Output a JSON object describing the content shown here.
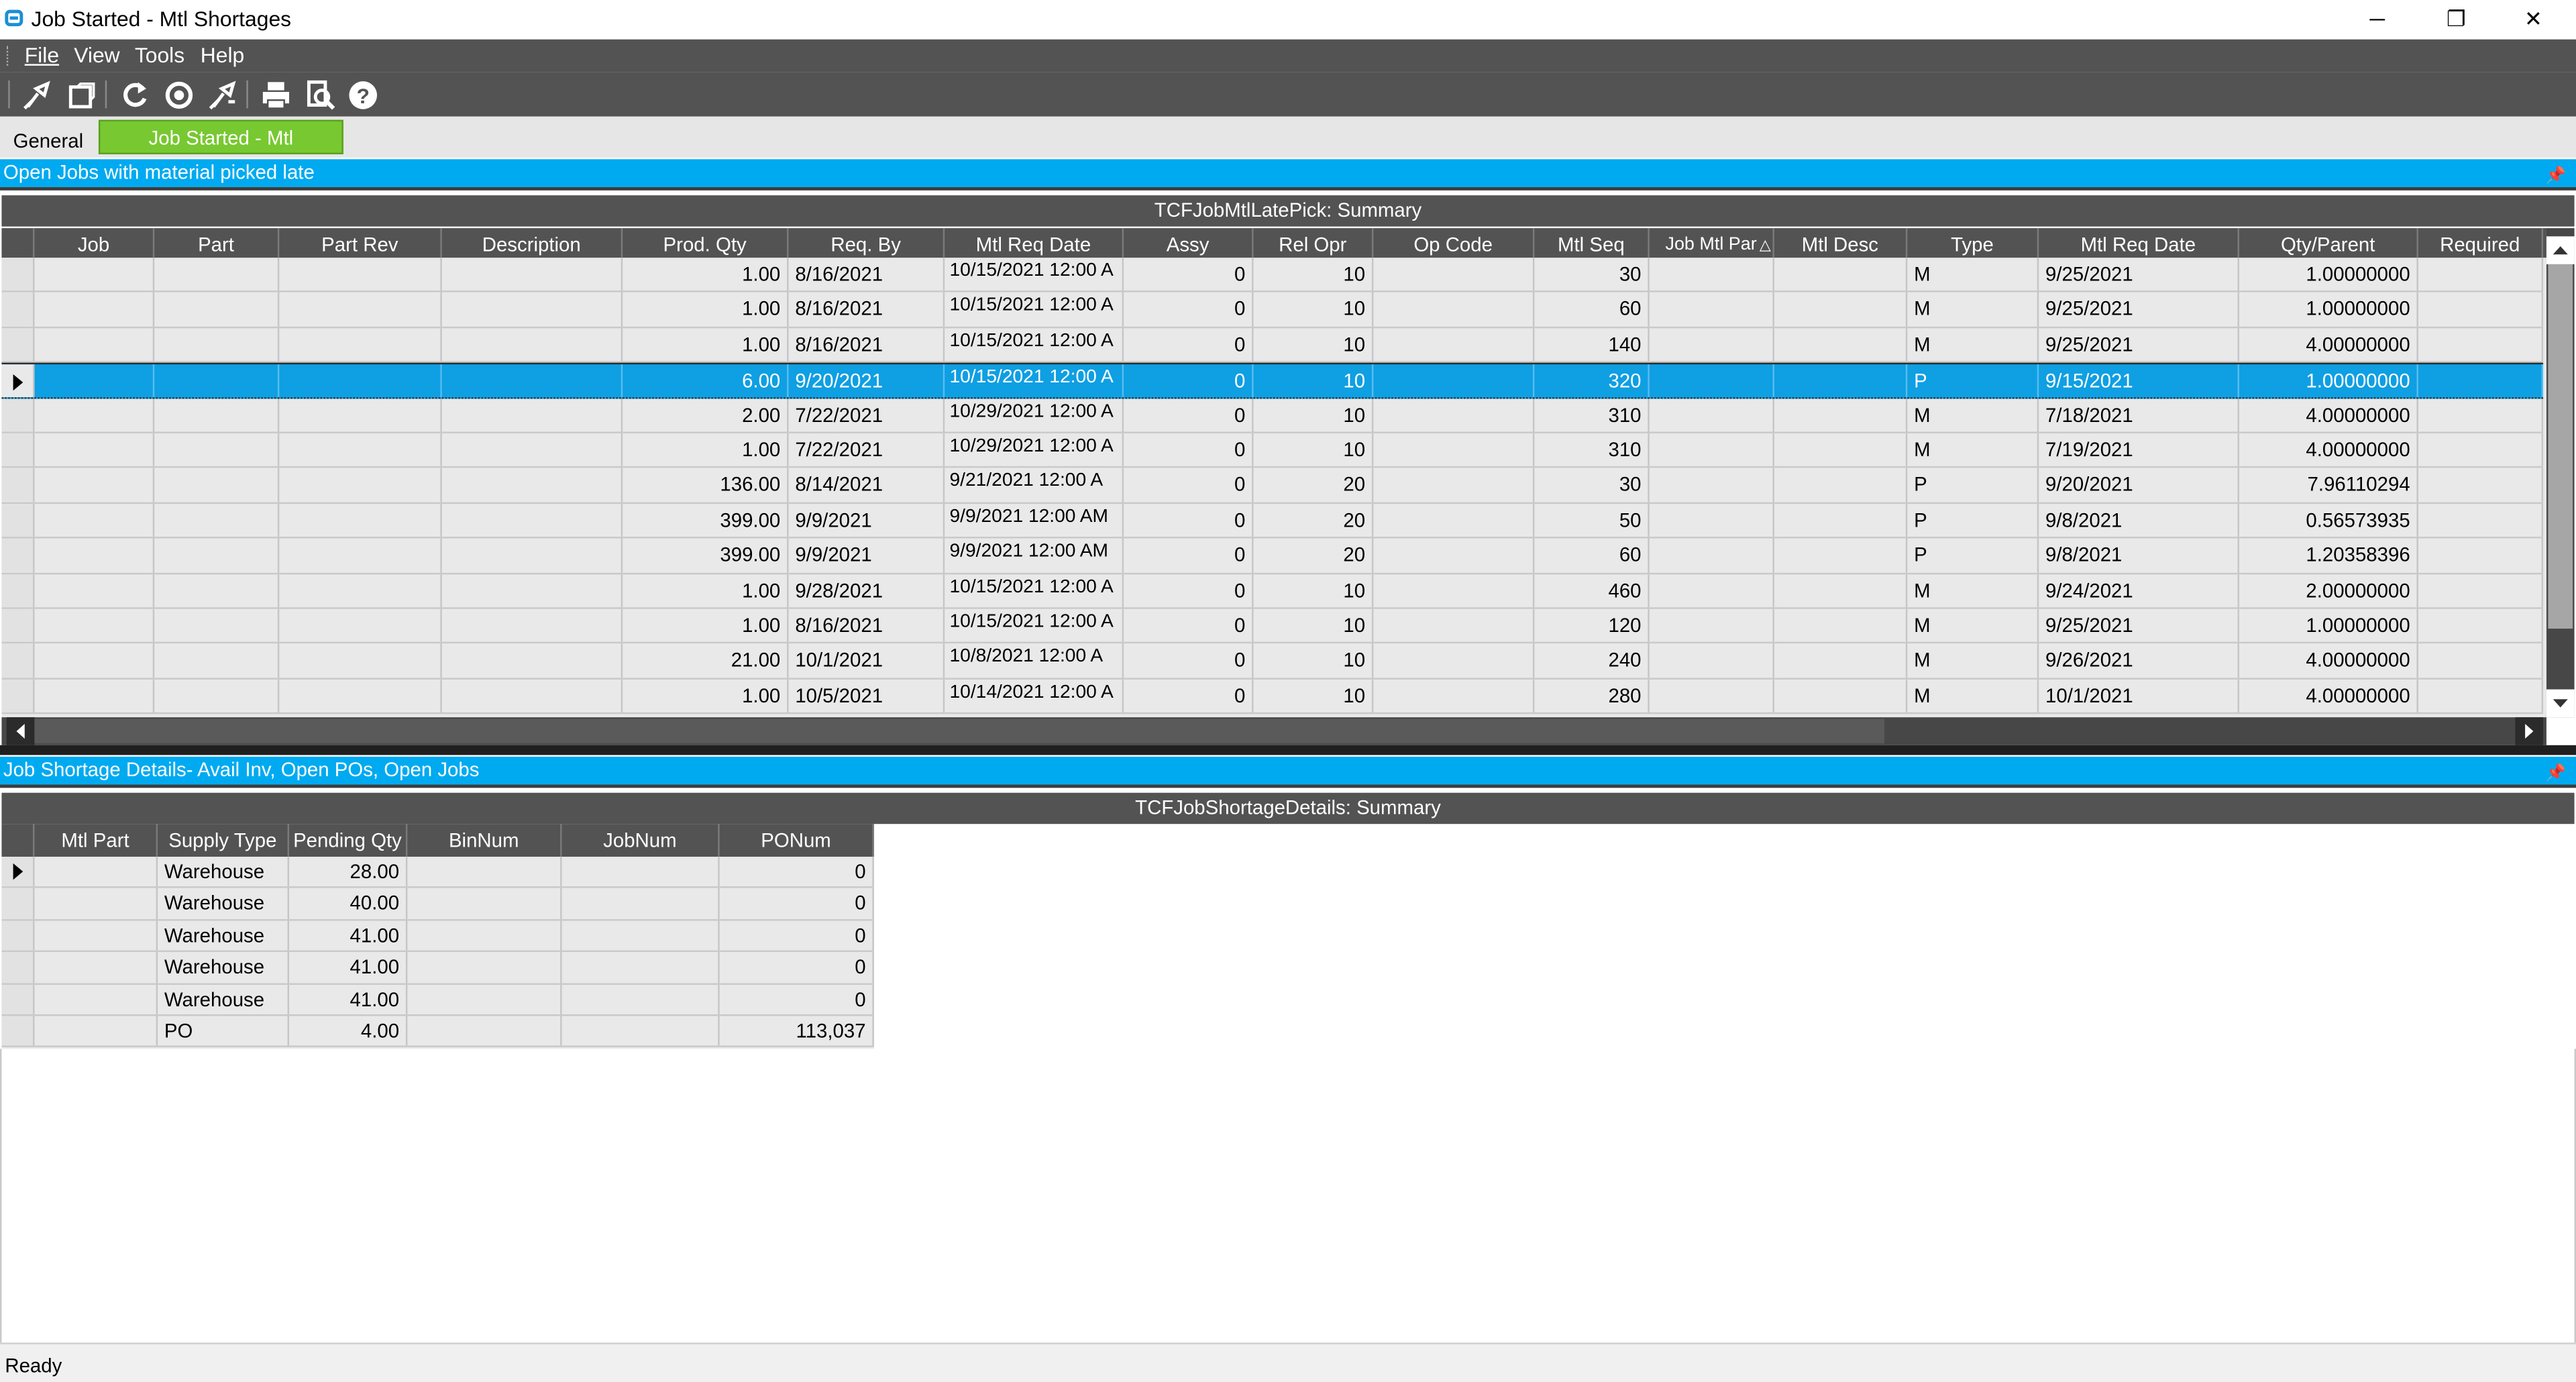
{
  "window": {
    "title": "Job Started - Mtl Shortages"
  },
  "menu": [
    "File",
    "View",
    "Tools",
    "Help"
  ],
  "toolbar_icons": [
    "clear-icon",
    "new-window-icon",
    "refresh-icon",
    "refresh-all-icon",
    "clear-all-icon",
    "print-icon",
    "print-preview-icon",
    "help-icon"
  ],
  "tabs": [
    {
      "label": "General",
      "active": false
    },
    {
      "label": "Job Started - Mtl Shortages",
      "active": true
    }
  ],
  "panel1": {
    "header": "Open Jobs with material picked late",
    "caption": "TCFJobMtlLatePick: Summary",
    "columns": [
      "Job",
      "Part",
      "Part Rev",
      "Description",
      "Prod. Qty",
      "Req. By",
      "Mtl Req Date",
      "Assy",
      "Rel Opr",
      "Op Code",
      "Mtl Seq",
      "Job Mtl Par",
      "Mtl Desc",
      "Type",
      "Mtl Req Date",
      "Qty/Parent",
      "Required"
    ],
    "selected_row": 3,
    "rows": [
      [
        "",
        "",
        "",
        "",
        "1.00",
        "8/16/2021",
        "10/15/2021 12:00 A",
        "0",
        "10",
        "",
        "30",
        "",
        "",
        "M",
        "9/25/2021",
        "1.00000000",
        ""
      ],
      [
        "",
        "",
        "",
        "",
        "1.00",
        "8/16/2021",
        "10/15/2021 12:00 A",
        "0",
        "10",
        "",
        "60",
        "",
        "",
        "M",
        "9/25/2021",
        "1.00000000",
        ""
      ],
      [
        "",
        "",
        "",
        "",
        "1.00",
        "8/16/2021",
        "10/15/2021 12:00 A",
        "0",
        "10",
        "",
        "140",
        "",
        "",
        "M",
        "9/25/2021",
        "4.00000000",
        ""
      ],
      [
        "",
        "",
        "",
        "",
        "6.00",
        "9/20/2021",
        "10/15/2021 12:00 A",
        "0",
        "10",
        "",
        "320",
        "",
        "",
        "P",
        "9/15/2021",
        "1.00000000",
        ""
      ],
      [
        "",
        "",
        "",
        "",
        "2.00",
        "7/22/2021",
        "10/29/2021 12:00 A",
        "0",
        "10",
        "",
        "310",
        "",
        "",
        "M",
        "7/18/2021",
        "4.00000000",
        ""
      ],
      [
        "",
        "",
        "",
        "",
        "1.00",
        "7/22/2021",
        "10/29/2021 12:00 A",
        "0",
        "10",
        "",
        "310",
        "",
        "",
        "M",
        "7/19/2021",
        "4.00000000",
        ""
      ],
      [
        "",
        "",
        "",
        "",
        "136.00",
        "8/14/2021",
        "9/21/2021 12:00 A",
        "0",
        "20",
        "",
        "30",
        "",
        "",
        "P",
        "9/20/2021",
        "7.96110294",
        ""
      ],
      [
        "",
        "",
        "",
        "",
        "399.00",
        "9/9/2021",
        "9/9/2021 12:00 AM",
        "0",
        "20",
        "",
        "50",
        "",
        "",
        "P",
        "9/8/2021",
        "0.56573935",
        ""
      ],
      [
        "",
        "",
        "",
        "",
        "399.00",
        "9/9/2021",
        "9/9/2021 12:00 AM",
        "0",
        "20",
        "",
        "60",
        "",
        "",
        "P",
        "9/8/2021",
        "1.20358396",
        ""
      ],
      [
        "",
        "",
        "",
        "",
        "1.00",
        "9/28/2021",
        "10/15/2021 12:00 A",
        "0",
        "10",
        "",
        "460",
        "",
        "",
        "M",
        "9/24/2021",
        "2.00000000",
        ""
      ],
      [
        "",
        "",
        "",
        "",
        "1.00",
        "8/16/2021",
        "10/15/2021 12:00 A",
        "0",
        "10",
        "",
        "120",
        "",
        "",
        "M",
        "9/25/2021",
        "1.00000000",
        ""
      ],
      [
        "",
        "",
        "",
        "",
        "21.00",
        "10/1/2021",
        "10/8/2021 12:00 A",
        "0",
        "10",
        "",
        "240",
        "",
        "",
        "M",
        "9/26/2021",
        "4.00000000",
        ""
      ],
      [
        "",
        "",
        "",
        "",
        "1.00",
        "10/5/2021",
        "10/14/2021 12:00 A",
        "0",
        "10",
        "",
        "280",
        "",
        "",
        "M",
        "10/1/2021",
        "4.00000000",
        ""
      ]
    ]
  },
  "panel2": {
    "header": "Job Shortage Details- Avail Inv, Open POs, Open Jobs",
    "caption": "TCFJobShortageDetails: Summary",
    "columns": [
      "Mtl Part",
      "Supply Type",
      "Pending Qty",
      "BinNum",
      "JobNum",
      "PONum"
    ],
    "selected_row": 0,
    "rows": [
      [
        "",
        "Warehouse",
        "28.00",
        "",
        "",
        "0"
      ],
      [
        "",
        "Warehouse",
        "40.00",
        "",
        "",
        "0"
      ],
      [
        "",
        "Warehouse",
        "41.00",
        "",
        "",
        "0"
      ],
      [
        "",
        "Warehouse",
        "41.00",
        "",
        "",
        "0"
      ],
      [
        "",
        "Warehouse",
        "41.00",
        "",
        "",
        "0"
      ],
      [
        "",
        "PO",
        "4.00",
        "",
        "",
        "113,037"
      ]
    ]
  },
  "status": "Ready"
}
